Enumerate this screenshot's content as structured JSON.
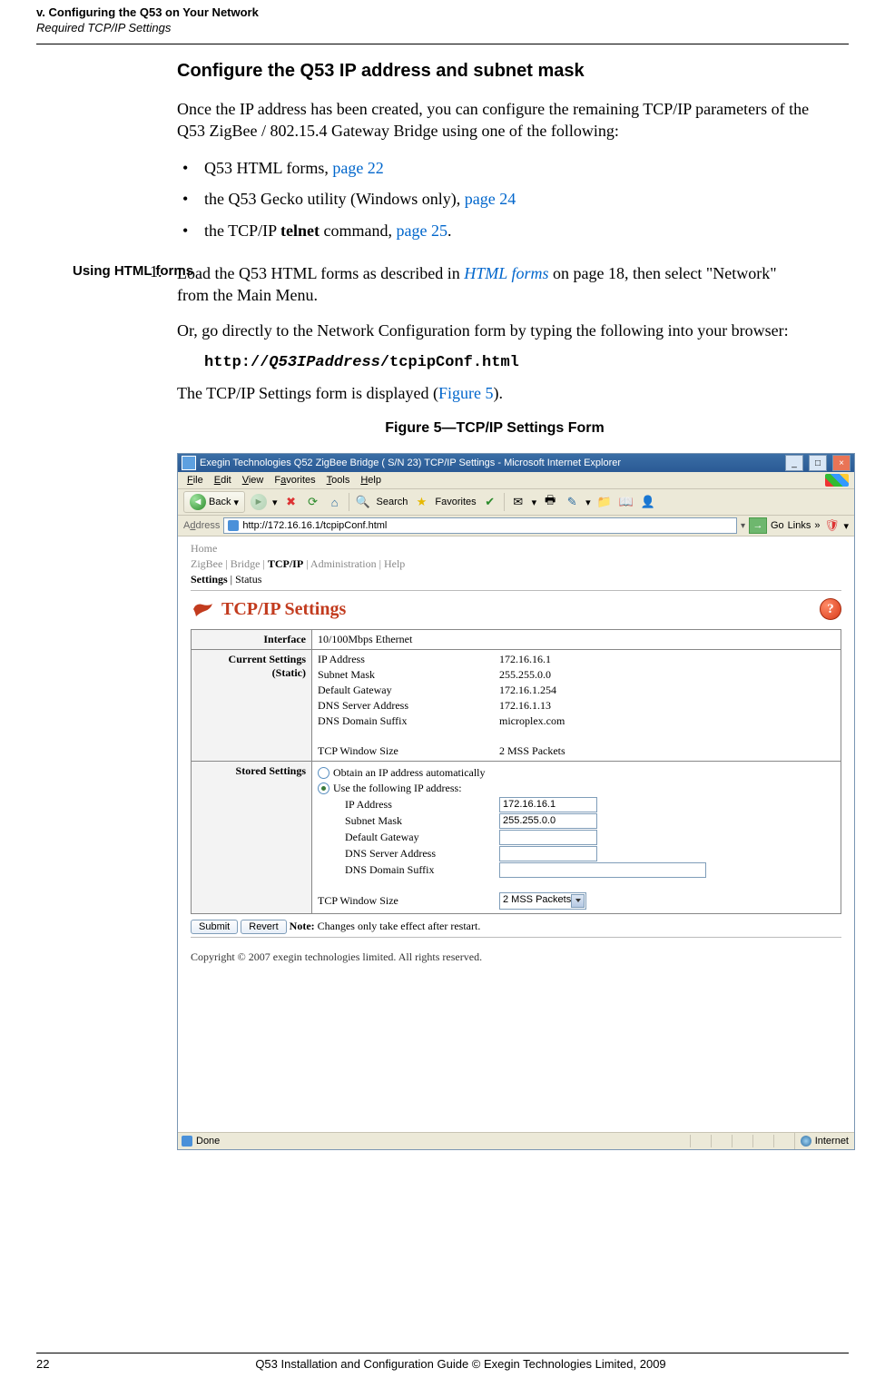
{
  "running_header": "v. Configuring the Q53 on Your Network",
  "running_subheader": "Required TCP/IP Settings",
  "heading": "Configure the Q53 IP address and subnet mask",
  "intro": "Once the IP address has been created, you can configure the remaining TCP/IP parameters of the Q53 ZigBee / 802.15.4 Gateway Bridge using one of the following:",
  "bullets": {
    "b1_text": "Q53 HTML forms, ",
    "b1_link": "page 22",
    "b2_text": "the Q53 Gecko utility (Windows only), ",
    "b2_link": "page 24",
    "b3_pre": "the TCP/IP ",
    "b3_bold": "telnet",
    "b3_post": " command, ",
    "b3_link": "page 25",
    "b3_end": "."
  },
  "side_label": "Using HTML forms",
  "step1": {
    "num": "1.",
    "text_pre": "Load the Q53 HTML forms as described in ",
    "text_link": "HTML forms",
    "text_post": " on page 18, then select \"Network\" from the Main Menu."
  },
  "step1b": "Or, go directly to the Network Configuration form by typing the following into your browser:",
  "code": {
    "pre": "http://",
    "mid": "Q53IPaddress",
    "post": "/tcpipConf.html"
  },
  "step1c_pre": "The TCP/IP Settings form is displayed (",
  "step1c_link": "Figure 5",
  "step1c_post": ").",
  "figure_caption": "Figure 5—TCP/IP Settings Form",
  "browser": {
    "title": "Exegin Technologies Q52 ZigBee Bridge ( S/N 23) TCP/IP Settings - Microsoft Internet Explorer",
    "menus": {
      "file": "File",
      "edit": "Edit",
      "view": "View",
      "favorites": "Favorites",
      "tools": "Tools",
      "help": "Help"
    },
    "toolbar": {
      "back": "Back",
      "search": "Search",
      "favorites": "Favorites"
    },
    "address_label": "Address",
    "address_url": "http://172.16.16.1/tcpipConf.html",
    "go": "Go",
    "links": "Links",
    "crumb": {
      "home": "Home",
      "row1_a": "ZigBee",
      "row1_b": "Bridge",
      "row1_c": "TCP/IP",
      "row1_d": "Administration",
      "row1_e": "Help",
      "row2_a": "Settings",
      "row2_b": "Status"
    },
    "settings_title": "TCP/IP Settings",
    "help": "?",
    "rows": {
      "interface_label": "Interface",
      "interface_val": "10/100Mbps Ethernet",
      "current_label": "Current Settings (Static)",
      "stored_label": "Stored Settings",
      "labels": {
        "ip": "IP Address",
        "mask": "Subnet Mask",
        "gw": "Default Gateway",
        "dns": "DNS Server Address",
        "suffix": "DNS Domain Suffix",
        "tcpwin": "TCP Window Size"
      },
      "current_vals": {
        "ip": "172.16.16.1",
        "mask": "255.255.0.0",
        "gw": "172.16.1.254",
        "dns": "172.16.1.13",
        "suffix": "microplex.com",
        "tcpwin": "2 MSS Packets"
      },
      "radios": {
        "auto": "Obtain an IP address automatically",
        "manual": "Use the following IP address:"
      },
      "stored_vals": {
        "ip": "172.16.16.1",
        "mask": "255.255.0.0",
        "gw": "",
        "dns": "",
        "suffix": "",
        "tcpwin": "2 MSS Packets"
      }
    },
    "buttons": {
      "submit": "Submit",
      "revert": "Revert"
    },
    "note_b": "Note:",
    "note": " Changes only take effect after restart.",
    "copyright": "Copyright © 2007 exegin technologies limited. All rights reserved.",
    "status_done": "Done",
    "status_zone": "Internet"
  },
  "footer": {
    "page_num": "22",
    "text": "Q53 Installation and Configuration Guide  © Exegin Technologies Limited, 2009"
  }
}
